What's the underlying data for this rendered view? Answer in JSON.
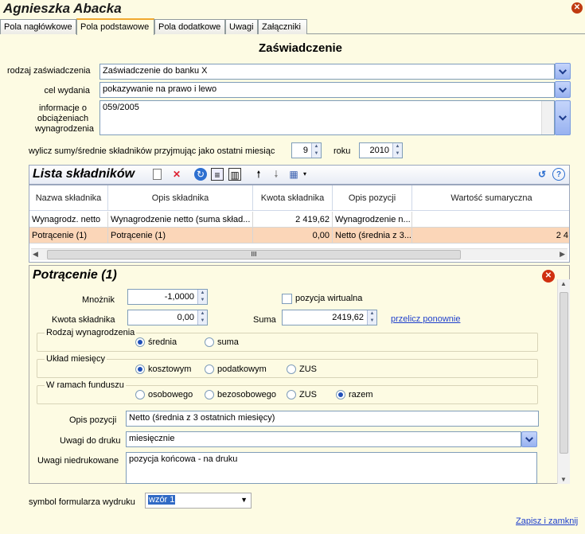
{
  "window": {
    "title": "Agnieszka Abacka"
  },
  "tabs": [
    "Pola nagłówkowe",
    "Pola podstawowe",
    "Pola dodatkowe",
    "Uwagi",
    "Załączniki"
  ],
  "form": {
    "title": "Zaświadczenie",
    "rodzaj_label": "rodzaj zaświadczenia",
    "rodzaj_value": "Zaświadczenie do banku X",
    "cel_label": "cel wydania",
    "cel_value": "pokazywanie na prawo i lewo",
    "info_label": "informacje o obciążeniach wynagrodzenia",
    "info_value": "059/2005",
    "wylicz_label": "wylicz sumy/średnie składników przyjmując jako ostatni miesiąc",
    "month_value": "9",
    "roku_label": "roku",
    "year_value": "2010"
  },
  "list": {
    "title": "Lista składników",
    "columns": [
      "Nazwa składnika",
      "Opis składnika",
      "Kwota składnika",
      "Opis pozycji",
      "Wartość sumaryczna"
    ],
    "rows": [
      [
        "Wynagrodz. netto",
        "Wynagrodzenie netto (suma skład...",
        "2 419,62",
        "Wynagrodzenie n...",
        ""
      ],
      [
        "Potrącenie (1)",
        "Potrącenie (1)",
        "0,00",
        "Netto (średnia z 3...",
        "2 4"
      ]
    ],
    "scroll_grip": "III"
  },
  "detail": {
    "title": "Potrącenie (1)",
    "mnoznik_label": "Mnożnik",
    "mnoznik_value": "-1,0000",
    "wirtualna_label": "pozycja wirtualna",
    "kwota_label": "Kwota składnika",
    "kwota_value": "0,00",
    "suma_label": "Suma",
    "suma_value": "2419,62",
    "przelicz_label": "przelicz ponownie",
    "rodzaj_wyn_label": "Rodzaj wynagrodzenia",
    "rodzaj_wyn_options": [
      "średnia",
      "suma"
    ],
    "uklad_label": "Układ miesięcy",
    "uklad_options": [
      "kosztowym",
      "podatkowym",
      "ZUS"
    ],
    "fundusz_label": "W ramach funduszu",
    "fundusz_options": [
      "osobowego",
      "bezosobowego",
      "ZUS",
      "razem"
    ],
    "opis_label": "Opis pozycji",
    "opis_value": "Netto (średnia z 3 ostatnich miesięcy)",
    "uwagi_druk_label": "Uwagi do druku",
    "uwagi_druk_value": "miesięcznie",
    "uwagi_nie_label": "Uwagi niedrukowane",
    "uwagi_nie_value": "pozycja końcowa - na druku"
  },
  "footer": {
    "symbol_label": "symbol formularza wydruku",
    "symbol_value": "wzór 1",
    "save_label": "Zapisz i zamknij"
  },
  "colors": {
    "accent": "#1f4fb8",
    "selected_row": "#fbd6b8",
    "link": "#1e3fcc"
  }
}
